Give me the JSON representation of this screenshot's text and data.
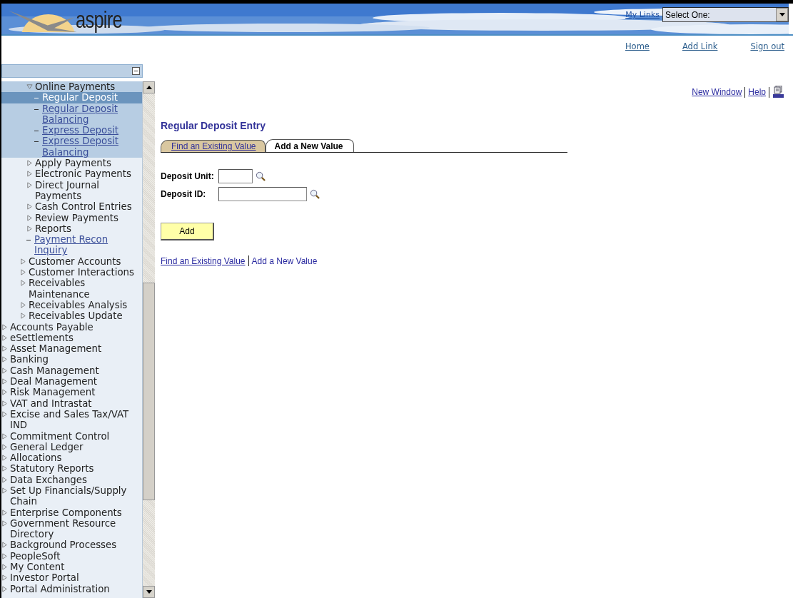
{
  "header": {
    "logo_text": "aspire",
    "my_links": "My Links",
    "select": {
      "value": "Select One:"
    }
  },
  "top_links": [
    "Home",
    "Add Link",
    "Sign out"
  ],
  "menu": {
    "items": [
      {
        "children": [
          {
            "children": [
              {
                "kind": "folder",
                "label": "Online Payments",
                "expanded": true,
                "children": [
                  {
                    "kind": "link",
                    "label": "Regular Deposit",
                    "selected": true
                  },
                  {
                    "kind": "link",
                    "label": "Regular Deposit Balancing",
                    "selected": false
                  },
                  {
                    "kind": "link",
                    "label": "Express Deposit",
                    "selected": false
                  },
                  {
                    "kind": "link",
                    "label": "Express Deposit Balancing",
                    "selected": false
                  }
                ]
              },
              {
                "kind": "folder",
                "label": "Apply Payments",
                "expanded": false
              },
              {
                "kind": "folder",
                "label": "Electronic Payments",
                "expanded": false
              },
              {
                "kind": "folder",
                "label": "Direct Journal Payments",
                "expanded": false
              },
              {
                "kind": "folder",
                "label": "Cash Control Entries",
                "expanded": false
              },
              {
                "kind": "folder",
                "label": "Review Payments",
                "expanded": false
              },
              {
                "kind": "folder",
                "label": "Reports",
                "expanded": false
              },
              {
                "kind": "link",
                "label": "Payment Recon Inquiry",
                "selected": false
              }
            ]
          },
          {
            "kind": "folder",
            "label": "Customer Accounts",
            "expanded": false
          },
          {
            "kind": "folder",
            "label": "Customer Interactions",
            "expanded": false
          },
          {
            "kind": "folder",
            "label": "Receivables Maintenance",
            "expanded": false
          },
          {
            "kind": "folder",
            "label": "Receivables Analysis",
            "expanded": false
          },
          {
            "kind": "folder",
            "label": "Receivables Update",
            "expanded": false
          }
        ]
      },
      {
        "kind": "folder",
        "label": "Accounts Payable",
        "expanded": false
      },
      {
        "kind": "folder",
        "label": "eSettlements",
        "expanded": false
      },
      {
        "kind": "folder",
        "label": "Asset Management",
        "expanded": false
      },
      {
        "kind": "folder",
        "label": "Banking",
        "expanded": false
      },
      {
        "kind": "folder",
        "label": "Cash Management",
        "expanded": false
      },
      {
        "kind": "folder",
        "label": "Deal Management",
        "expanded": false
      },
      {
        "kind": "folder",
        "label": "Risk Management",
        "expanded": false
      },
      {
        "kind": "folder",
        "label": "VAT and Intrastat",
        "expanded": false
      },
      {
        "kind": "folder",
        "label": "Excise and Sales Tax/VAT IND",
        "expanded": false
      },
      {
        "kind": "folder",
        "label": "Commitment Control",
        "expanded": false
      },
      {
        "kind": "folder",
        "label": "General Ledger",
        "expanded": false
      },
      {
        "kind": "folder",
        "label": "Allocations",
        "expanded": false
      },
      {
        "kind": "folder",
        "label": "Statutory Reports",
        "expanded": false
      },
      {
        "kind": "folder",
        "label": "Data Exchanges",
        "expanded": false
      },
      {
        "kind": "folder",
        "label": "Set Up Financials/Supply Chain",
        "expanded": false
      },
      {
        "kind": "folder",
        "label": "Enterprise Components",
        "expanded": false
      },
      {
        "kind": "folder",
        "label": "Government Resource Directory",
        "expanded": false
      },
      {
        "kind": "folder",
        "label": "Background Processes",
        "expanded": false
      },
      {
        "kind": "folder",
        "label": "PeopleSoft",
        "expanded": false
      },
      {
        "kind": "folder",
        "label": "My Content",
        "expanded": false
      },
      {
        "kind": "folder",
        "label": "Investor Portal",
        "expanded": false
      },
      {
        "kind": "folder",
        "label": "Portal Administration",
        "expanded": false
      }
    ]
  },
  "page_links": [
    "New Window",
    "Help"
  ],
  "title": "Regular Deposit Entry",
  "tabs": [
    {
      "label": "Find an Existing Value",
      "selected": false
    },
    {
      "label": "Add a New Value",
      "selected": true
    }
  ],
  "fields": [
    {
      "label": "Deposit Unit:"
    },
    {
      "label": "Deposit ID:"
    }
  ],
  "add_button": "Add",
  "bottom_links": [
    {
      "label": "Find an Existing Value",
      "kind": "link"
    },
    {
      "label": "Add a New Value",
      "kind": "text"
    }
  ]
}
